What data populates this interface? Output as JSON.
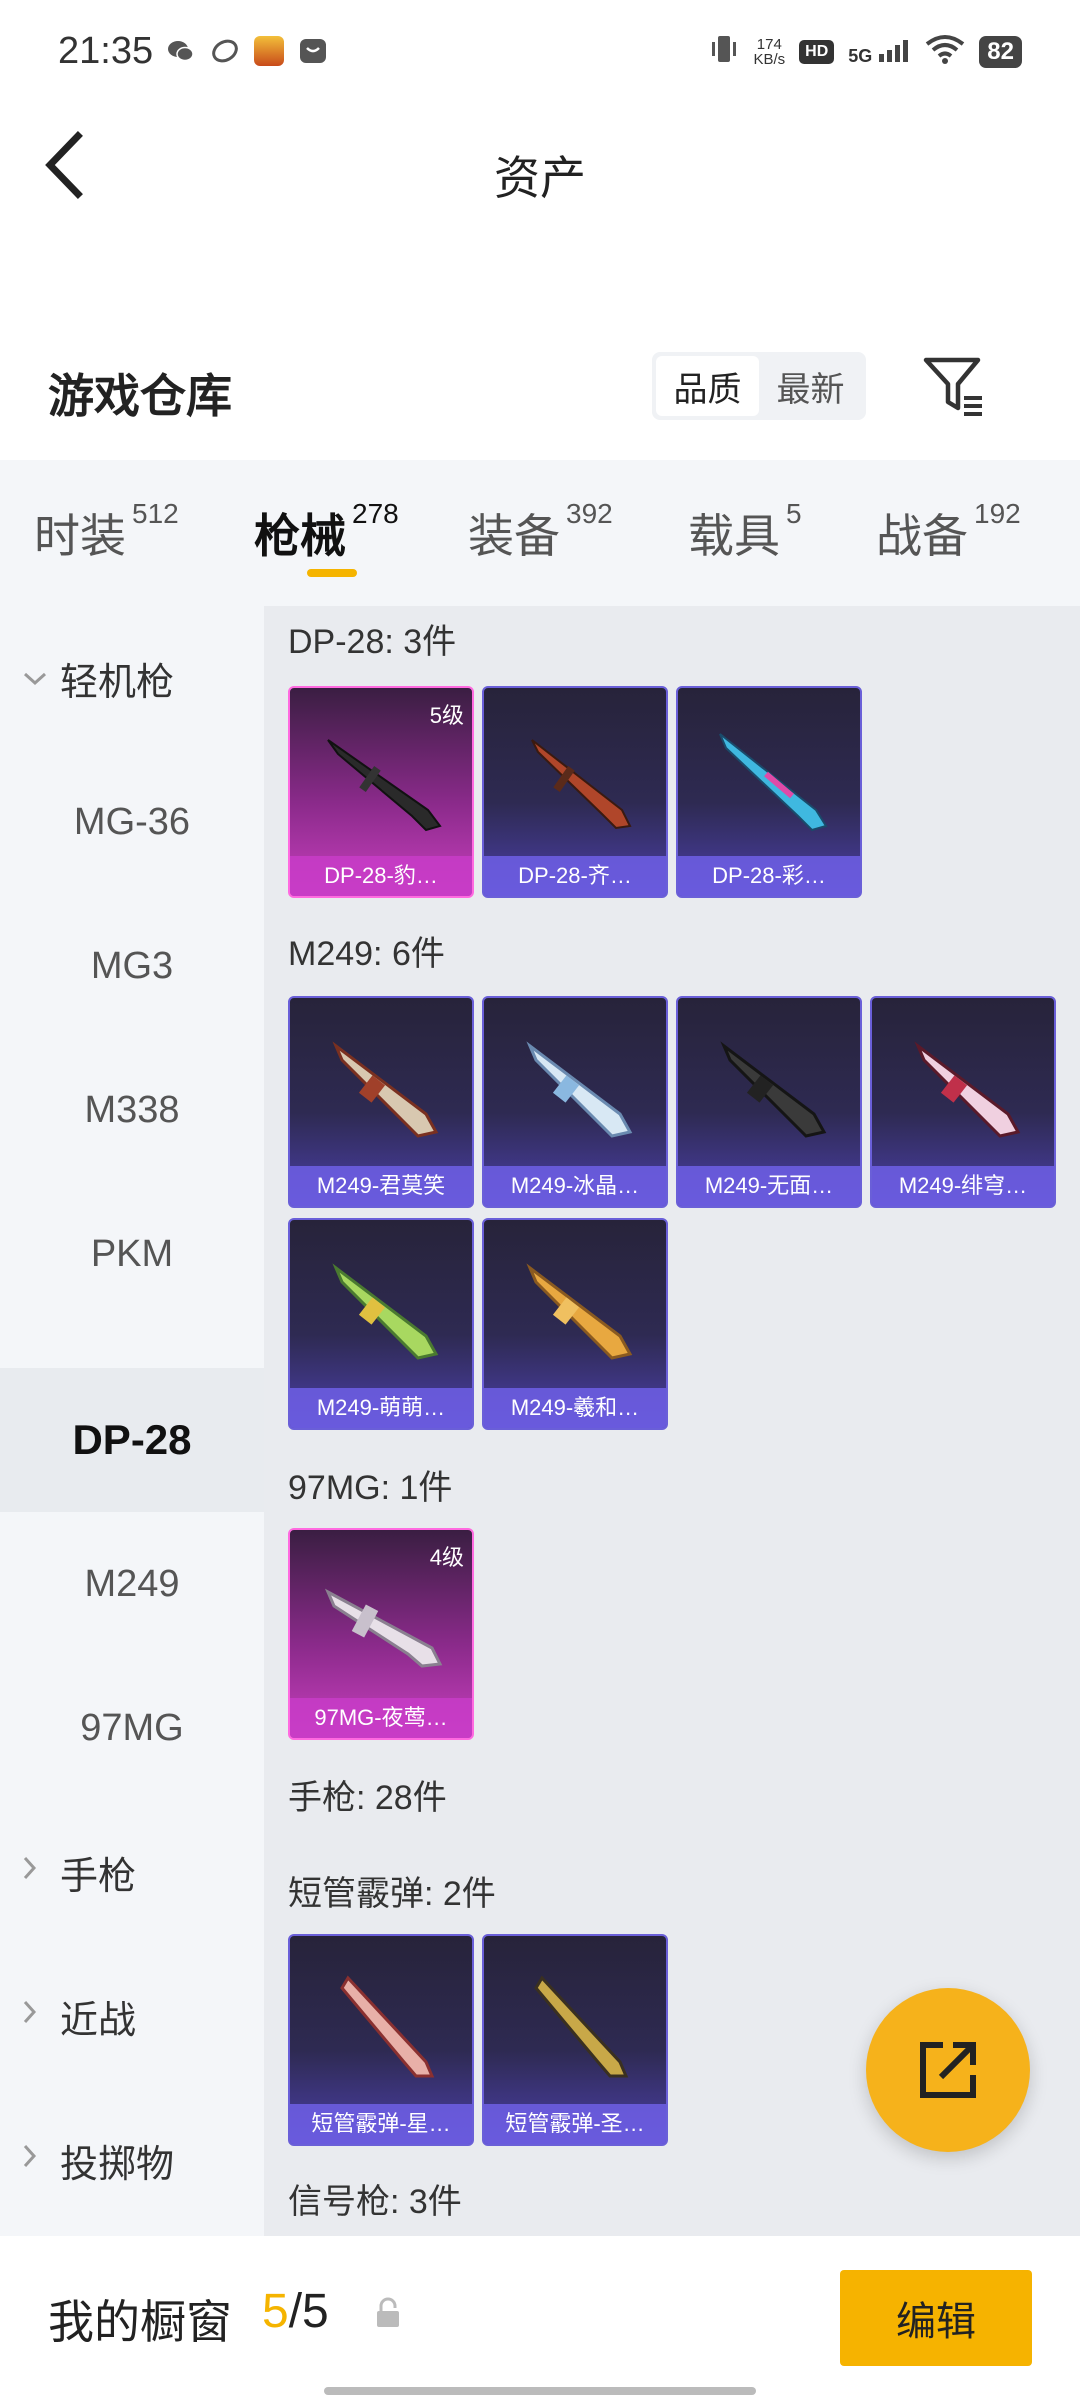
{
  "status_bar": {
    "time": "21:35",
    "speed_value": "174",
    "speed_unit": "KB/s",
    "hd": "HD",
    "network": "5G",
    "battery": "82",
    "icons": [
      "wechat-icon",
      "app-icon",
      "game-icon",
      "message-icon",
      "vibrate-icon",
      "wifi-icon"
    ]
  },
  "header": {
    "title": "资产"
  },
  "warehouse": {
    "title": "游戏仓库",
    "sort_options": [
      "品质",
      "最新"
    ],
    "active_sort": "品质"
  },
  "tabs": [
    {
      "label": "时装",
      "count": "512"
    },
    {
      "label": "枪械",
      "count": "278",
      "active": true
    },
    {
      "label": "装备",
      "count": "392"
    },
    {
      "label": "载具",
      "count": "5"
    },
    {
      "label": "战备",
      "count": "192"
    }
  ],
  "left_nav": [
    {
      "label": "轻机枪",
      "type": "group",
      "expanded": true
    },
    {
      "label": "MG-36"
    },
    {
      "label": "MG3"
    },
    {
      "label": "M338"
    },
    {
      "label": "PKM"
    },
    {
      "label": "DP-28",
      "selected": true
    },
    {
      "label": "M249"
    },
    {
      "label": "97MG"
    },
    {
      "label": "手枪",
      "type": "group"
    },
    {
      "label": "近战",
      "type": "group"
    },
    {
      "label": "投掷物",
      "type": "group"
    }
  ],
  "sections": [
    {
      "title": "DP-28: 3件",
      "items": [
        {
          "name": "DP-28-豹…",
          "level": "5级",
          "tier": "magenta"
        },
        {
          "name": "DP-28-齐…"
        },
        {
          "name": "DP-28-彩…"
        }
      ]
    },
    {
      "title": "M249: 6件",
      "items": [
        {
          "name": "M249-君莫笑"
        },
        {
          "name": "M249-冰晶…"
        },
        {
          "name": "M249-无面…"
        },
        {
          "name": "M249-绯穹…"
        },
        {
          "name": "M249-萌萌…"
        },
        {
          "name": "M249-羲和…"
        }
      ]
    },
    {
      "title": "97MG: 1件",
      "items": [
        {
          "name": "97MG-夜莺…",
          "level": "4级",
          "tier": "magenta"
        }
      ]
    },
    {
      "title": "手枪: 28件",
      "items": []
    },
    {
      "title": "短管霰弹: 2件",
      "items": [
        {
          "name": "短管霰弹-星…"
        },
        {
          "name": "短管霰弹-圣…"
        }
      ]
    },
    {
      "title": "信号枪: 3件",
      "items": []
    }
  ],
  "bottom": {
    "label": "我的橱窗",
    "current": "5",
    "separator": "/",
    "total": "5",
    "edit_label": "编辑"
  },
  "colors": {
    "accent": "#f5b400",
    "card_purple": "#4b3fa8",
    "card_magenta": "#c83fbe"
  }
}
